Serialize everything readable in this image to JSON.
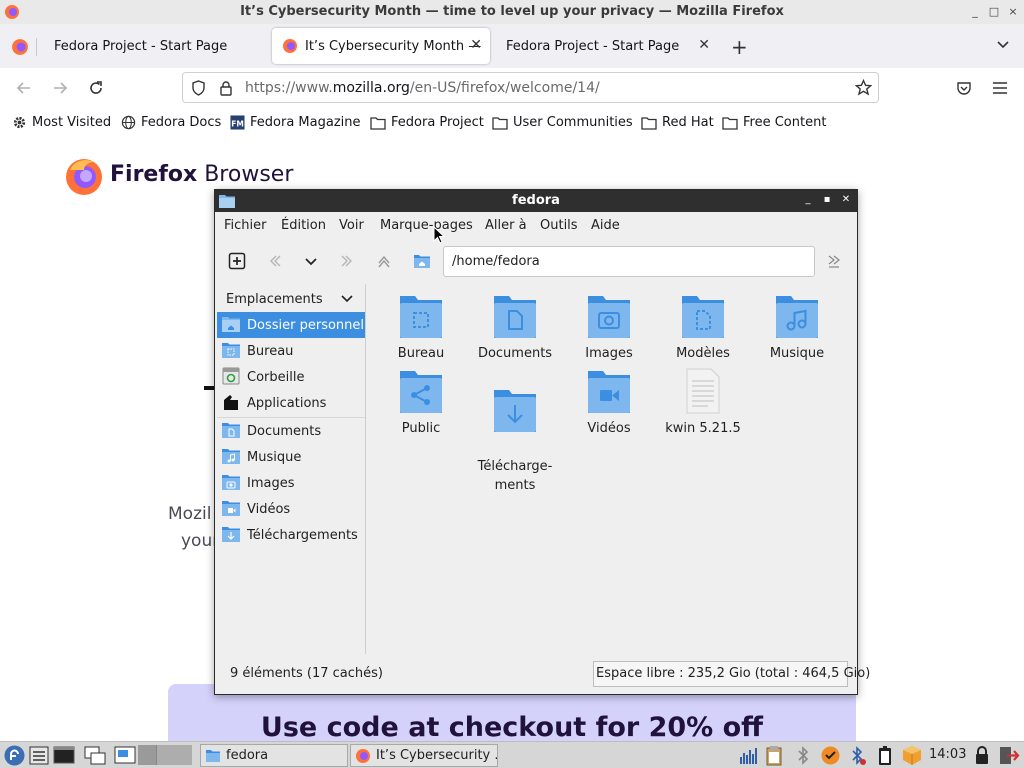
{
  "window": {
    "title": "It’s Cybersecurity Month — time to level up your privacy — Mozilla Firefox"
  },
  "tabs": [
    {
      "label": "Fedora Project - Start Page",
      "active": false
    },
    {
      "label": "It’s Cybersecurity Month —",
      "active": true
    },
    {
      "label": "Fedora Project - Start Page",
      "active": false
    }
  ],
  "urlbar": {
    "prefix": "https://www.",
    "domain": "mozilla.org",
    "path": "/en-US/firefox/welcome/14/"
  },
  "bookmarks": [
    {
      "label": "Most Visited",
      "icon": "gear-icon"
    },
    {
      "label": "Fedora Docs",
      "icon": "globe-icon"
    },
    {
      "label": "Fedora Magazine",
      "icon": "fm-icon"
    },
    {
      "label": "Fedora Project",
      "icon": "folder-icon"
    },
    {
      "label": "User Communities",
      "icon": "folder-icon"
    },
    {
      "label": "Red Hat",
      "icon": "folder-icon"
    },
    {
      "label": "Free Content",
      "icon": "folder-icon"
    }
  ],
  "page": {
    "brand_first": "Firefox",
    "brand_second": "Browser",
    "frag1": "Mozil",
    "frag2": "your",
    "promo": "Use code at checkout for 20% off"
  },
  "fm": {
    "title": "fedora",
    "menu": [
      "Fichier",
      "Édition",
      "Voir",
      "Marque-pages",
      "Aller à",
      "Outils",
      "Aide"
    ],
    "path": "/home/fedora",
    "sidebar_header": "Emplacements",
    "places": [
      {
        "label": "Dossier personnel",
        "icon": "home-folder-icon",
        "selected": true
      },
      {
        "label": "Bureau",
        "icon": "desktop-folder-icon",
        "selected": false
      },
      {
        "label": "Corbeille",
        "icon": "trash-icon",
        "selected": false
      },
      {
        "label": "Applications",
        "icon": "applications-icon",
        "selected": false
      },
      {
        "label": "Documents",
        "icon": "documents-folder-icon",
        "selected": false
      },
      {
        "label": "Musique",
        "icon": "music-folder-icon",
        "selected": false
      },
      {
        "label": "Images",
        "icon": "images-folder-icon",
        "selected": false
      },
      {
        "label": "Vidéos",
        "icon": "videos-folder-icon",
        "selected": false
      },
      {
        "label": "Téléchargements",
        "icon": "downloads-folder-icon",
        "selected": false
      }
    ],
    "items": [
      {
        "label": "Bureau",
        "icon": "desktop-folder-icon"
      },
      {
        "label": "Documents",
        "icon": "documents-folder-icon"
      },
      {
        "label": "Images",
        "icon": "images-folder-icon"
      },
      {
        "label": "Modèles",
        "icon": "templates-folder-icon"
      },
      {
        "label": "Musique",
        "icon": "music-folder-icon"
      },
      {
        "label": "Public",
        "icon": "public-folder-icon"
      },
      {
        "label": "Télécharge-\nments",
        "icon": "downloads-folder-icon"
      },
      {
        "label": "Vidéos",
        "icon": "videos-folder-icon"
      },
      {
        "label": "kwin 5.21.5",
        "icon": "text-file-icon"
      }
    ],
    "status_left": "9 éléments (17 cachés)",
    "status_right": "Espace libre : 235,2 Gio (total : 464,5 Gio)"
  },
  "taskbar": {
    "tasks": [
      {
        "label": "fedora",
        "icon": "folder-icon"
      },
      {
        "label": "It’s Cybersecurity ...",
        "icon": "firefox-icon"
      }
    ],
    "clock": "14:03"
  },
  "colors": {
    "folder_blue": "#3c8ee1",
    "folder_light": "#7db7ee",
    "selection": "#3c8ee1",
    "promo_bg": "#d4d2fb",
    "dark_title": "#2f2f2f"
  }
}
